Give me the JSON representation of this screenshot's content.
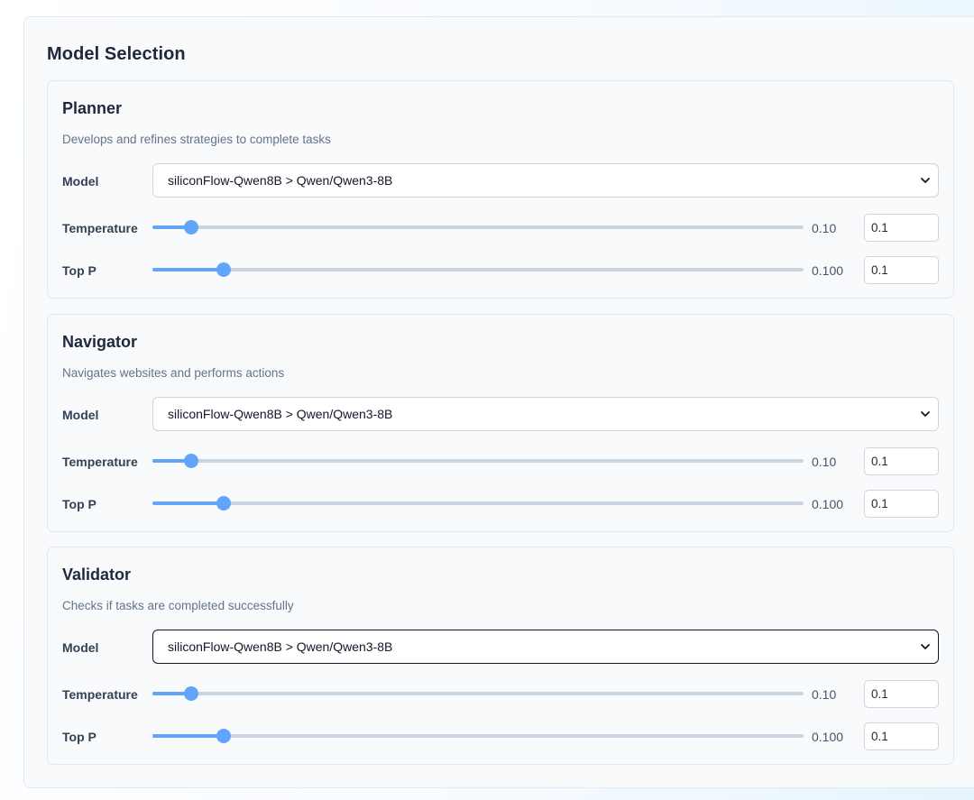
{
  "section": {
    "title": "Model Selection"
  },
  "agents": [
    {
      "name": "Planner",
      "description": "Develops and refines strategies to complete tasks",
      "model_label": "Model",
      "model_value": "siliconFlow-Qwen8B > Qwen/Qwen3-8B",
      "temperature_label": "Temperature",
      "temperature_fraction": 0.06,
      "temperature_display": "0.10",
      "temperature_input": "0.1",
      "top_p_label": "Top P",
      "top_p_fraction": 0.109,
      "top_p_display": "0.100",
      "top_p_input": "0.1"
    },
    {
      "name": "Navigator",
      "description": "Navigates websites and performs actions",
      "model_label": "Model",
      "model_value": "siliconFlow-Qwen8B > Qwen/Qwen3-8B",
      "temperature_label": "Temperature",
      "temperature_fraction": 0.06,
      "temperature_display": "0.10",
      "temperature_input": "0.1",
      "top_p_label": "Top P",
      "top_p_fraction": 0.109,
      "top_p_display": "0.100",
      "top_p_input": "0.1"
    },
    {
      "name": "Validator",
      "description": "Checks if tasks are completed successfully",
      "model_label": "Model",
      "model_value": "siliconFlow-Qwen8B > Qwen/Qwen3-8B",
      "temperature_label": "Temperature",
      "temperature_fraction": 0.06,
      "temperature_display": "0.10",
      "temperature_input": "0.1",
      "top_p_label": "Top P",
      "top_p_fraction": 0.109,
      "top_p_display": "0.100",
      "top_p_input": "0.1"
    }
  ],
  "colors": {
    "accent": "#60a5fa",
    "track": "#cbd5e1"
  },
  "icons": {
    "select_arrow": "chevron-down-icon"
  }
}
